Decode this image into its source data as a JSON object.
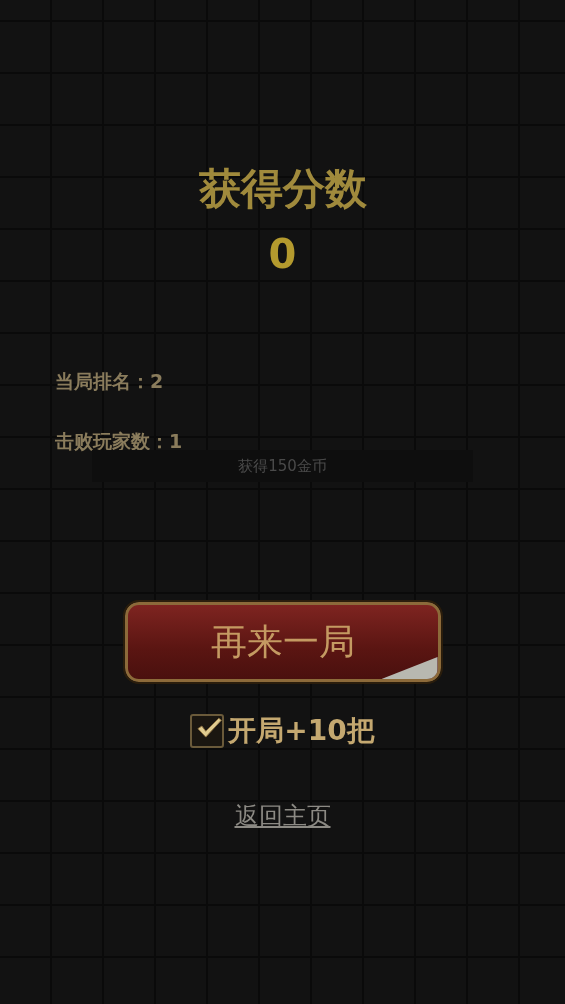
{
  "score": {
    "title": "获得分数",
    "value": "0"
  },
  "stats": [
    {
      "text": "当局排名：2"
    },
    {
      "text": "击败玩家数：1"
    }
  ],
  "reward": "获得150金币",
  "replay_button": "再来一局",
  "option": {
    "label": "开局+10把",
    "checked": true
  },
  "home_link": "返回主页"
}
